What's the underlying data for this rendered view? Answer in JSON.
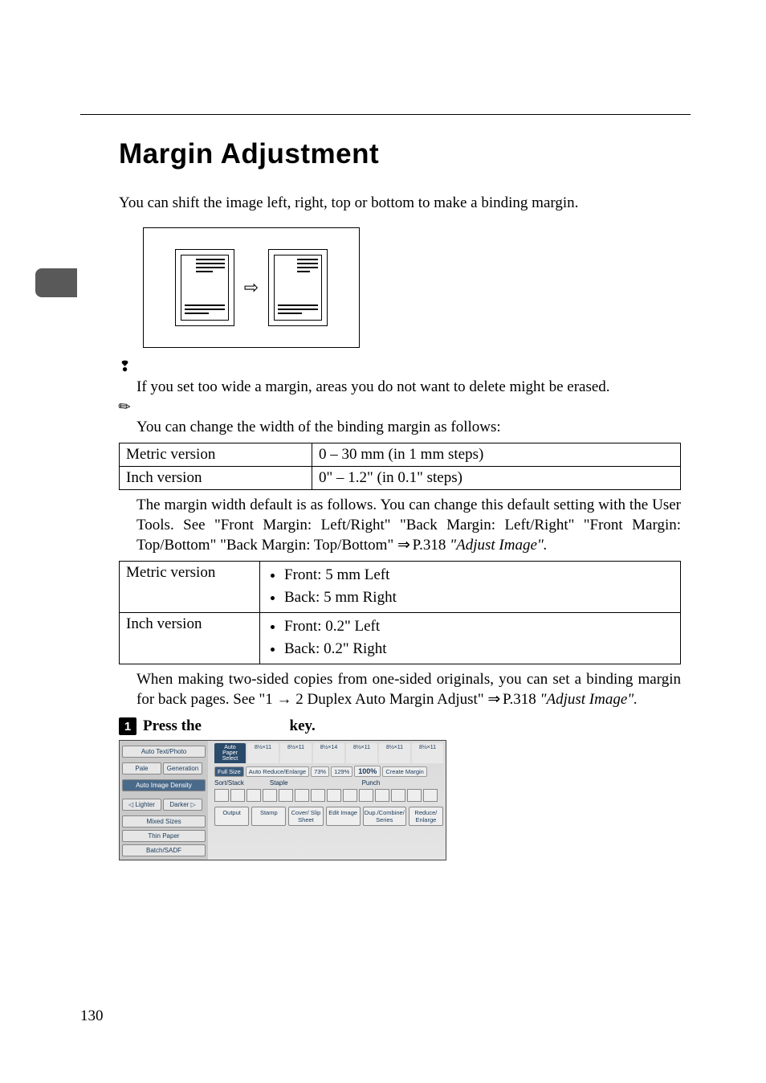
{
  "page_number": "130",
  "heading": "Margin Adjustment",
  "intro": "You can shift the image left, right, top or bottom to make a binding margin.",
  "limitation": "If you set too wide a margin, areas you do not want to delete might be erased.",
  "note1": "You can change the width of the binding margin as follows:",
  "table1": {
    "r1c1": "Metric version",
    "r1c2": "0 – 30 mm (in 1 mm steps)",
    "r2c1": "Inch version",
    "r2c2": "0\" – 1.2\" (in 0.1\" steps)"
  },
  "para1_a": "The margin width default is as follows. You can change this default setting with the User Tools. See \"Front Margin: Left/Right\" \"Back Margin: Left/Right\" \"Front Margin: Top/Bottom\" \"Back Margin: Top/Bottom\" ",
  "para1_ref": " P.318",
  "para1_b": " \"Adjust Image\".",
  "table2": {
    "r1c1": "Metric version",
    "r1c2a": "Front: 5 mm Left",
    "r1c2b": "Back: 5 mm Right",
    "r2c1": "Inch version",
    "r2c2a": "Front: 0.2\" Left",
    "r2c2b": "Back: 0.2\" Right"
  },
  "para2_a": "When making two-sided copies from one-sided originals, you can set a binding margin for back pages. See \"1 ",
  "para2_arrow": " 2 Duplex Auto Margin Adjust\" ",
  "para2_ref": " P.318",
  "para2_b": " \"Adjust Image\".",
  "step1_num": "1",
  "step1_a": "Press the ",
  "step1_b": " key.",
  "panel": {
    "auto_text_photo": "Auto Text/Photo",
    "pale": "Pale",
    "generation": "Generation",
    "auto_image_density": "Auto Image Density",
    "lighter": "Lighter",
    "darker": "Darker",
    "mixed_sizes": "Mixed Sizes",
    "thin_paper": "Thin Paper",
    "batch_sadf": "Batch/SADF",
    "auto_paper_select": "Auto Paper Select",
    "tabs": [
      "8½×11",
      "8½×11",
      "8½×14",
      "8½×11",
      "8½×11",
      "8½×11"
    ],
    "full_size": "Full Size",
    "auto_re": "Auto Reduce/Enlarge",
    "p73": "73%",
    "p129": "129%",
    "p100": "100%",
    "create_margin": "Create Margin",
    "sort_stack": "Sort/Stack",
    "staple": "Staple",
    "punch": "Punch",
    "funcs": [
      "Output",
      "Stamp",
      "Cover/ Slip Sheet",
      "Edit Image",
      "Dup./Combine/ Series",
      "Reduce/ Enlarge"
    ]
  }
}
